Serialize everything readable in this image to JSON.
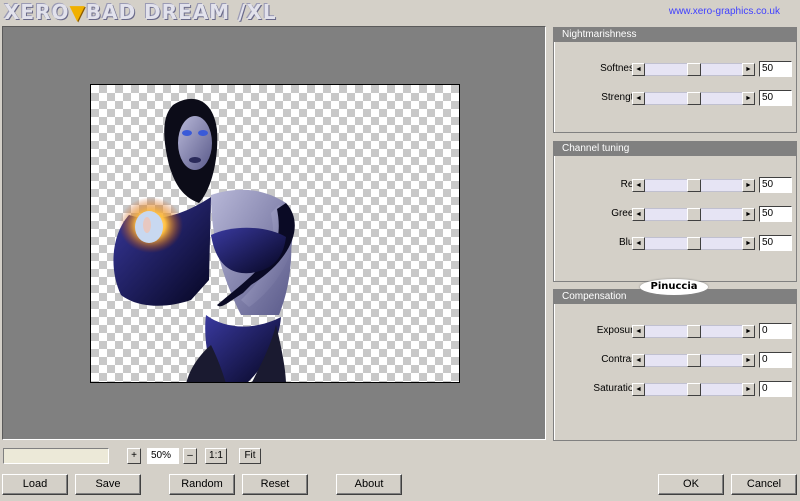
{
  "header": {
    "title_part1": "XERO",
    "title_accent": "▼",
    "title_part2": "BAD DREAM /XL",
    "url": "www.xero-graphics.co.uk"
  },
  "panels": {
    "nightmarishness": {
      "title": "Nightmarishness",
      "params": [
        {
          "label": "Softness",
          "value": "50",
          "level": 50
        },
        {
          "label": "Strength",
          "value": "50",
          "level": 50
        }
      ]
    },
    "channel": {
      "title": "Channel tuning",
      "params": [
        {
          "label": "Red",
          "value": "50",
          "level": 50
        },
        {
          "label": "Green",
          "value": "50",
          "level": 50
        },
        {
          "label": "Blue",
          "value": "50",
          "level": 50
        }
      ]
    },
    "compensation": {
      "title": "Compensation",
      "params": [
        {
          "label": "Exposure",
          "value": "0",
          "level": 50
        },
        {
          "label": "Contrast",
          "value": "0",
          "level": 50
        },
        {
          "label": "Saturation",
          "value": "0",
          "level": 50
        }
      ]
    }
  },
  "watermark": "Pinuccia",
  "zoom": {
    "plus": "+",
    "level": "50%",
    "minus": "–",
    "one_to_one": "1:1",
    "fit": "Fit"
  },
  "buttons": {
    "load": "Load",
    "save": "Save",
    "random": "Random",
    "reset": "Reset",
    "about": "About",
    "ok": "OK",
    "cancel": "Cancel"
  },
  "slider_arrows": {
    "left": "◄",
    "right": "►"
  },
  "colors": {
    "panel_header": "#808080",
    "slider_track": "#e6e4f4",
    "preview_bg": "#808080",
    "url": "#4040ff"
  }
}
